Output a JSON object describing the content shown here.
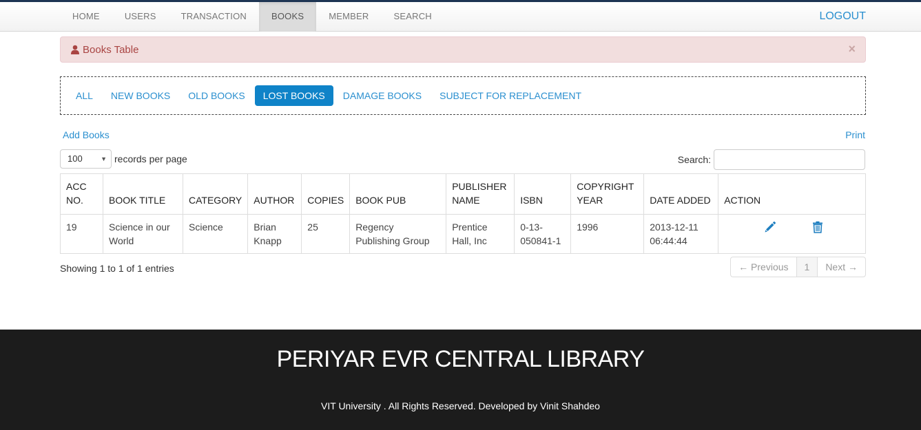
{
  "nav": {
    "items": [
      "HOME",
      "USERS",
      "TRANSACTION",
      "BOOKS",
      "MEMBER",
      "SEARCH"
    ],
    "logout": "LOGOUT"
  },
  "alert": {
    "title": "Books Table",
    "close": "×"
  },
  "filters": [
    "ALL",
    "NEW BOOKS",
    "OLD BOOKS",
    "LOST BOOKS",
    "DAMAGE BOOKS",
    "SUBJECT FOR REPLACEMENT"
  ],
  "actions": {
    "add": "Add Books",
    "print": "Print"
  },
  "table_controls": {
    "page_size": "100",
    "page_size_label": "records per page",
    "search_label": "Search:",
    "search_value": ""
  },
  "table": {
    "headers": [
      "ACC NO.",
      "BOOK TITLE",
      "CATEGORY",
      "AUTHOR",
      "COPIES",
      "BOOK PUB",
      "PUBLISHER NAME",
      "ISBN",
      "COPYRIGHT YEAR",
      "DATE ADDED",
      "ACTION"
    ],
    "rows": [
      {
        "acc_no": "19",
        "title": "Science in our World",
        "category": "Science",
        "author": "Brian Knapp",
        "copies": "25",
        "book_pub": "Regency Publishing Group",
        "publisher": "Prentice Hall, Inc",
        "isbn": "0-13-050841-1",
        "copyright_year": "1996",
        "date_added": "2013-12-11 06:44:44"
      }
    ]
  },
  "pagination": {
    "info": "Showing 1 to 1 of 1 entries",
    "previous": "← Previous",
    "current": "1",
    "next": "Next →"
  },
  "footer": {
    "title": "PERIYAR EVR CENTRAL LIBRARY",
    "copyright": "VIT University . All Rights Reserved. Developed by Vinit Shahdeo"
  },
  "colors": {
    "link": "#2a8fcf",
    "active_pill": "#0f83c8",
    "alert_bg": "#f2dede",
    "alert_text": "#a94442",
    "footer_bg": "#1c1c1c"
  },
  "icons": [
    "user-icon",
    "pencil-icon",
    "trash-icon"
  ]
}
